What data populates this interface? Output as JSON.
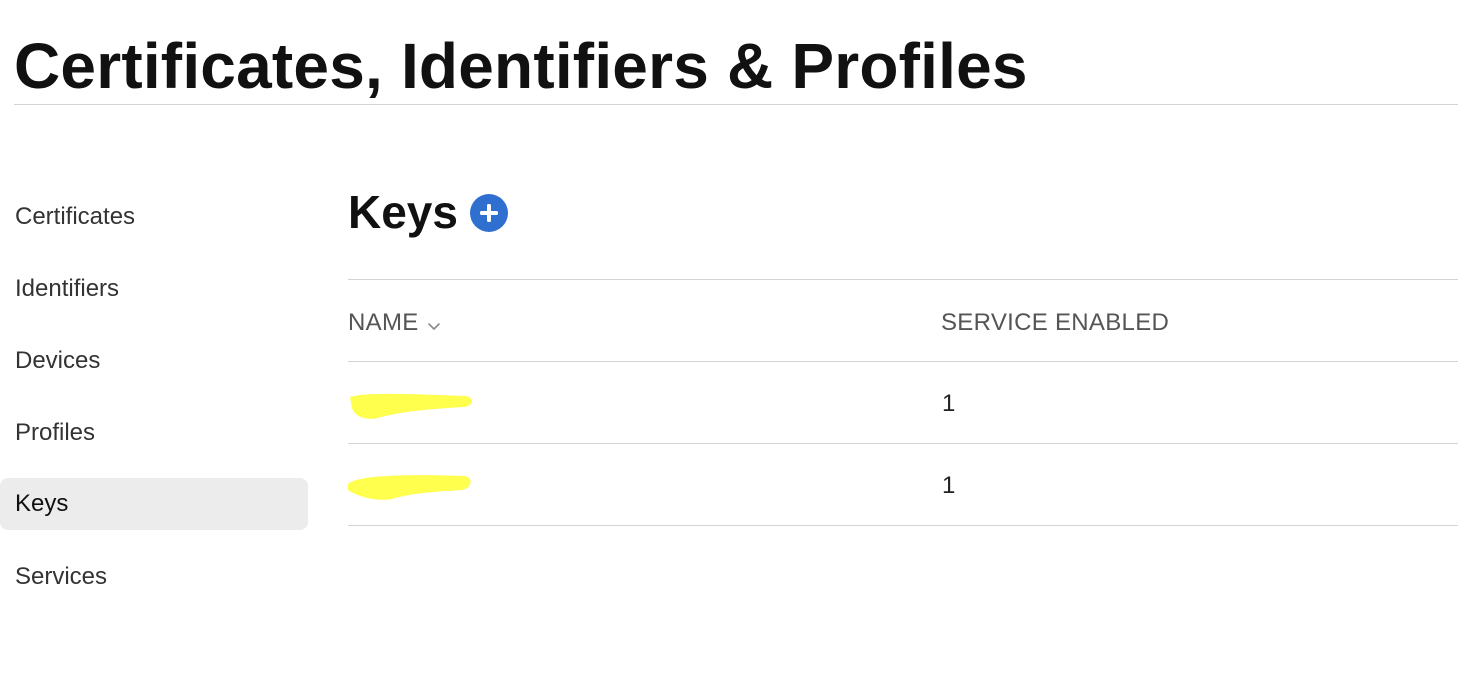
{
  "page": {
    "title": "Certificates, Identifiers & Profiles"
  },
  "sidebar": {
    "items": [
      {
        "label": "Certificates",
        "active": false
      },
      {
        "label": "Identifiers",
        "active": false
      },
      {
        "label": "Devices",
        "active": false
      },
      {
        "label": "Profiles",
        "active": false
      },
      {
        "label": "Keys",
        "active": true
      },
      {
        "label": "Services",
        "active": false
      }
    ]
  },
  "main": {
    "section_title": "Keys",
    "add_icon": "plus-circle-icon",
    "accent_color": "#2f6fd0",
    "highlight_color": "#ffff4d",
    "table": {
      "columns": [
        "NAME",
        "SERVICE ENABLED"
      ],
      "sort_icon": "chevron-down-icon",
      "rows": [
        {
          "name": "",
          "service_enabled": "1"
        },
        {
          "name": "",
          "service_enabled": "1"
        }
      ]
    }
  }
}
